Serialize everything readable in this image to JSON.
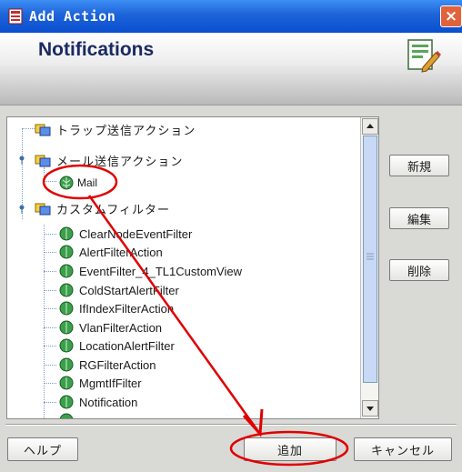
{
  "window": {
    "title": "Add Action",
    "close_glyph": "×"
  },
  "header": {
    "title": "Notifications",
    "icon": "document-edit-icon"
  },
  "tree": {
    "items": [
      {
        "label": "トラップ送信アクション",
        "kind": "folder"
      },
      {
        "label": "メール送信アクション",
        "kind": "folder"
      },
      {
        "label": "Mail",
        "kind": "leaf"
      },
      {
        "label": "カスタムフィルター",
        "kind": "folder"
      },
      {
        "label": "ClearNodeEventFilter",
        "kind": "leaf"
      },
      {
        "label": "AlertFilterAction",
        "kind": "leaf"
      },
      {
        "label": "EventFilter_4_TL1CustomView",
        "kind": "leaf"
      },
      {
        "label": "ColdStartAlertFilter",
        "kind": "leaf"
      },
      {
        "label": "IfIndexFilterAction",
        "kind": "leaf"
      },
      {
        "label": "VlanFilterAction",
        "kind": "leaf"
      },
      {
        "label": "LocationAlertFilter",
        "kind": "leaf"
      },
      {
        "label": "RGFilterAction",
        "kind": "leaf"
      },
      {
        "label": "MgmtIfFilter",
        "kind": "leaf"
      },
      {
        "label": "Notification",
        "kind": "leaf"
      }
    ]
  },
  "side_buttons": {
    "new": "新規",
    "edit": "編集",
    "delete": "削除"
  },
  "footer": {
    "help": "ヘルプ",
    "add": "追加",
    "cancel": "キャンセル"
  },
  "colors": {
    "annotation": "#e00000",
    "titlebar": "#0a4fd0",
    "header_title": "#1b2a62"
  }
}
